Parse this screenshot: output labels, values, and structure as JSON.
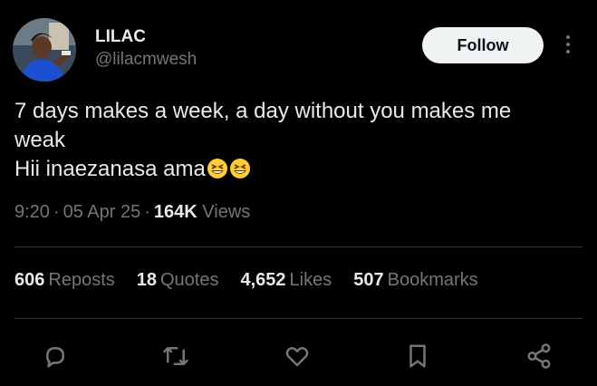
{
  "author": {
    "display_name": "LILAC",
    "handle": "@lilacmwesh"
  },
  "header": {
    "follow_label": "Follow",
    "more_icon": "more-vertical-icon"
  },
  "tweet": {
    "line1": "7 days makes a week, a day without you makes me",
    "line2": "weak",
    "line3": "Hii inaezanasa ama",
    "emojis": [
      "grinning-squinting-face",
      "grinning-squinting-face"
    ]
  },
  "meta": {
    "time": "9:20",
    "date": "05 Apr 25",
    "views_count": "164K",
    "views_label": "Views"
  },
  "stats": {
    "reposts_count": "606",
    "reposts_label": "Reposts",
    "quotes_count": "18",
    "quotes_label": "Quotes",
    "likes_count": "4,652",
    "likes_label": "Likes",
    "bookmarks_count": "507",
    "bookmarks_label": "Bookmarks"
  },
  "actions": [
    "reply-icon",
    "repost-icon",
    "like-icon",
    "bookmark-icon",
    "share-icon"
  ],
  "colors": {
    "background": "#000000",
    "text": "#e7e9ea",
    "secondary": "#71767b",
    "divider": "#2f3336",
    "follow_bg": "#eff3f4"
  }
}
